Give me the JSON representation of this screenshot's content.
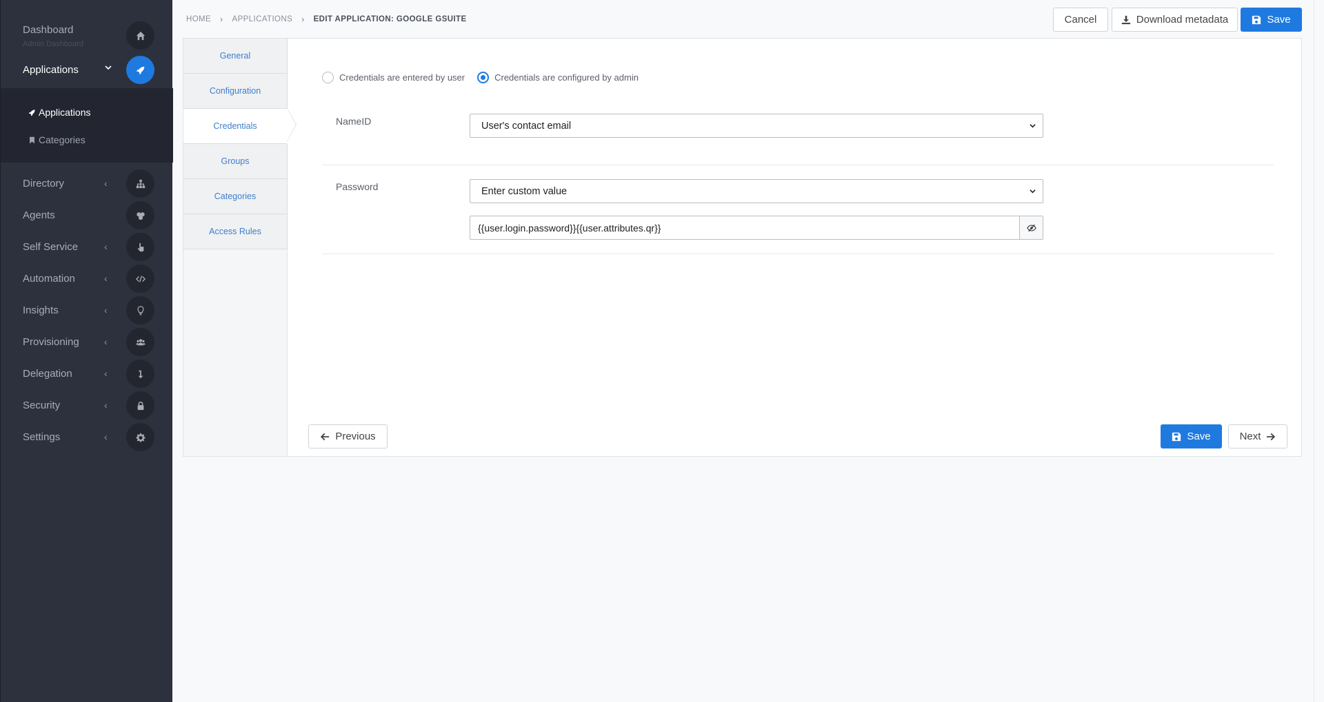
{
  "sidebar": {
    "dashboard": {
      "label": "Dashboard",
      "sublabel": "Admin Dashboard"
    },
    "applications": {
      "label": "Applications"
    },
    "submenu": [
      {
        "label": "Applications"
      },
      {
        "label": "Categories"
      }
    ],
    "items": [
      {
        "label": "Directory",
        "icon": "sitemap-icon"
      },
      {
        "label": "Agents",
        "icon": "agents-icon"
      },
      {
        "label": "Self Service",
        "icon": "hand-pointer-icon"
      },
      {
        "label": "Automation",
        "icon": "code-icon"
      },
      {
        "label": "Insights",
        "icon": "lightbulb-icon"
      },
      {
        "label": "Provisioning",
        "icon": "users-icon"
      },
      {
        "label": "Delegation",
        "icon": "level-down-icon"
      },
      {
        "label": "Security",
        "icon": "lock-icon"
      },
      {
        "label": "Settings",
        "icon": "gear-icon"
      }
    ]
  },
  "breadcrumb": {
    "home": "HOME",
    "applications": "APPLICATIONS",
    "current": "EDIT APPLICATION: GOOGLE GSUITE"
  },
  "toolbar": {
    "cancel": "Cancel",
    "download": "Download metadata",
    "save": "Save"
  },
  "tabs": [
    {
      "label": "General"
    },
    {
      "label": "Configuration"
    },
    {
      "label": "Credentials"
    },
    {
      "label": "Groups"
    },
    {
      "label": "Categories"
    },
    {
      "label": "Access Rules"
    }
  ],
  "credentials": {
    "radio_user": "Credentials are entered by user",
    "radio_admin": "Credentials are configured by admin",
    "selected_radio": "admin",
    "nameid_label": "NameID",
    "nameid_value": "User's contact email",
    "password_label": "Password",
    "password_mode": "Enter custom value",
    "password_value": "{{user.login.password}}{{user.attributes.qr}}"
  },
  "footer": {
    "previous": "Previous",
    "save": "Save",
    "next": "Next"
  },
  "colors": {
    "primary": "#1f7ae0",
    "sidebar_bg": "#2d313d"
  }
}
